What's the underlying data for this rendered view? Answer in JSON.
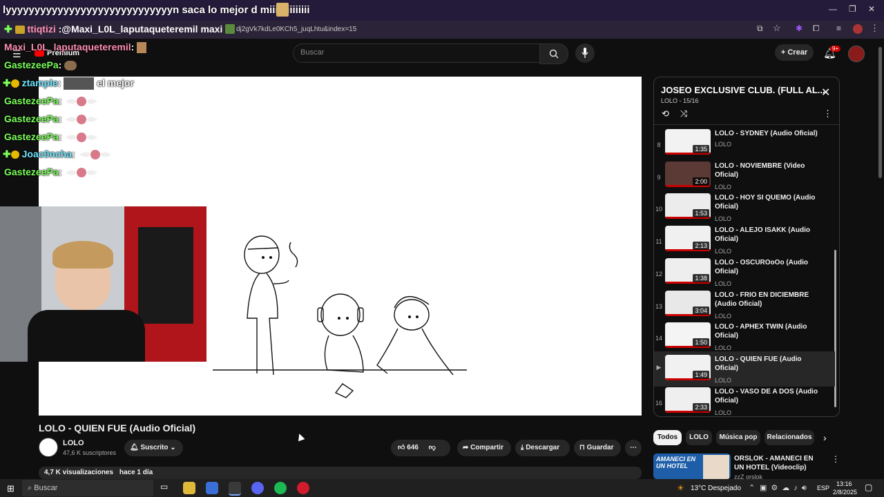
{
  "browser": {
    "tab_title": "lyyyyyyyyyyyyyyyyyyyyyyyyyyyyyn saca lo mejor d miiiiiiiiiiiiii",
    "url_fragment": "dj2gVk7kdLe0KCh5_juqLhtu&index=15"
  },
  "chat": {
    "overlay_line1_user": "ttiqtizi",
    "overlay_line1_text": ":@Maxi_L0L_laputaqueteremil maxi",
    "lines": [
      {
        "user": "Maxi_L0L_laputaqueteremil",
        "sep": ":",
        "text": ""
      },
      {
        "user": "GastezeePa",
        "sep": ":",
        "text": ""
      },
      {
        "user": "ztample",
        "sep": ":",
        "text": "el mejor"
      },
      {
        "user": "GastezeePa",
        "sep": ":",
        "text": ""
      },
      {
        "user": "GastezeePa",
        "sep": ":",
        "text": ""
      },
      {
        "user": "GastezeePa",
        "sep": ":",
        "text": ""
      },
      {
        "user": "Joac0ncha",
        "sep": ":",
        "text": ""
      },
      {
        "user": "GastezeePa",
        "sep": ":",
        "text": ""
      }
    ]
  },
  "header": {
    "logo_label": "Premium",
    "search_placeholder": "Buscar",
    "create_label": "Crear",
    "notif_badge": "9+"
  },
  "video": {
    "title": "LOLO - QUIEN FUE (Audio Oficial)",
    "channel": "LOLO",
    "subscribers": "47,6 K suscriptores",
    "subscribed_label": "Suscrito",
    "likes": "646",
    "share_label": "Compartir",
    "download_label": "Descargar",
    "save_label": "Guardar",
    "views": "4,7 K visualizaciones",
    "age": "hace 1 día"
  },
  "playlist": {
    "title": "JOSEO EXCLUSIVE CLUB. (FULL AL...",
    "subtitle": "LOLO - 15/16",
    "items": [
      {
        "num": "8",
        "title": "LOLO - SYDNEY (Audio Oficial)",
        "channel": "LOLO",
        "duration": "1:35"
      },
      {
        "num": "9",
        "title": "LOLO - NOVIEMBRE (Video Oficial)",
        "channel": "LOLO",
        "duration": "2:00"
      },
      {
        "num": "10",
        "title": "LOLO - HOY SI QUEMO (Audio Oficial)",
        "channel": "LOLO",
        "duration": "1:53"
      },
      {
        "num": "11",
        "title": "LOLO - ALEJO ISAKK (Audio Oficial)",
        "channel": "LOLO",
        "duration": "2:13"
      },
      {
        "num": "12",
        "title": "LOLO - OSCUROoOo (Audio Oficial)",
        "channel": "LOLO",
        "duration": "1:38"
      },
      {
        "num": "13",
        "title": "LOLO - FRIO EN DICIEMBRE (Audio Oficial)",
        "channel": "LOLO",
        "duration": "3:04"
      },
      {
        "num": "14",
        "title": "LOLO - APHEX TWIN (Audio Oficial)",
        "channel": "LOLO",
        "duration": "1:50"
      },
      {
        "num": "▶",
        "title": "LOLO - QUIEN FUE (Audio Oficial)",
        "channel": "LOLO",
        "duration": "1:49"
      },
      {
        "num": "16",
        "title": "LOLO - VASO DE A DOS (Audio Oficial)",
        "channel": "LOLO",
        "duration": "2:33"
      }
    ]
  },
  "chips": [
    "Todos",
    "LOLO",
    "Música pop",
    "Relacionados"
  ],
  "recommended": {
    "title": "ORSLOK - AMANECI EN UN HOTEL (Videoclip)",
    "channel": "zzZ orslok",
    "thumb_text": "AMANECI EN UN HOTEL"
  },
  "taskbar": {
    "search_label": "Buscar",
    "weather": "13°C Despejado",
    "lang": "ESP",
    "time": "13:16",
    "date": "2/8/2025"
  },
  "colors": {
    "accent_red": "#ff0000",
    "chat_green": "#7cff5a",
    "chat_pink": "#ff8fb3",
    "chat_cyan": "#6ee7ff"
  }
}
